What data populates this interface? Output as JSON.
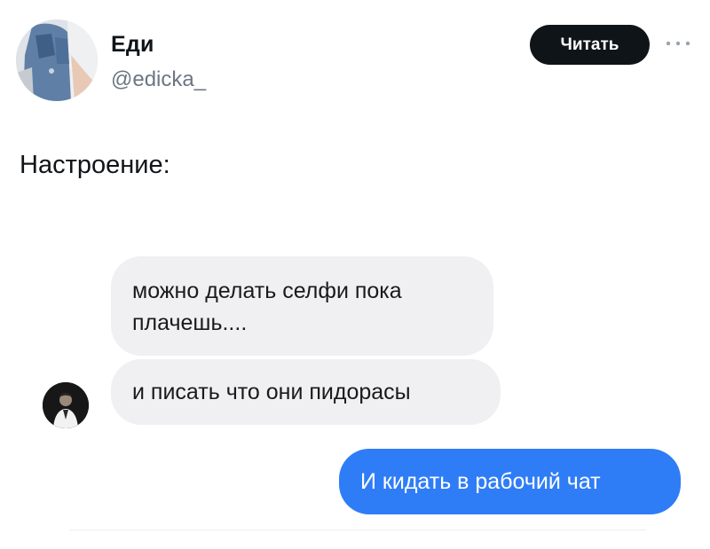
{
  "profile": {
    "display_name": "Еди",
    "handle": "@edicka_",
    "avatar_icon": "user-avatar-photo"
  },
  "actions": {
    "follow_label": "Читать",
    "more_icon": "more-horizontal-icon"
  },
  "tweet": {
    "text": "Настроение:"
  },
  "chat": {
    "messages": [
      {
        "direction": "incoming",
        "text": "можно делать селфи пока плачешь...."
      },
      {
        "direction": "incoming",
        "text": "и писать что они пидорасы"
      },
      {
        "direction": "outgoing",
        "text": "И кидать в рабочий чат"
      }
    ],
    "contact_avatar_icon": "contact-avatar-photo"
  },
  "colors": {
    "follow_button_bg": "#0f1419",
    "incoming_bubble_bg": "#f0f0f3",
    "outgoing_bubble_bg": "#2f7df6",
    "handle_text": "#6b7783"
  }
}
